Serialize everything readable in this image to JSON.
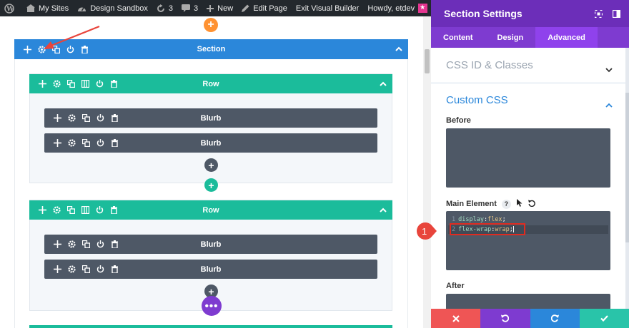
{
  "adminbar": {
    "my_sites": "My Sites",
    "site_name": "Design Sandbox",
    "updates": "3",
    "comments": "3",
    "new_label": "New",
    "edit_page": "Edit Page",
    "exit_builder": "Exit Visual Builder",
    "howdy": "Howdy, etdev"
  },
  "builder": {
    "section_label": "Section",
    "rows": [
      {
        "label": "Row",
        "modules": [
          "Blurb",
          "Blurb"
        ]
      },
      {
        "label": "Row",
        "modules": [
          "Blurb",
          "Blurb"
        ]
      }
    ],
    "colors": {
      "section": "#2b87da",
      "row": "#1bbc9b",
      "module": "#4e5866",
      "add_section": "#ff9232",
      "more": "#7e3bd0"
    }
  },
  "panel": {
    "title": "Section Settings",
    "tabs": [
      "Content",
      "Design",
      "Advanced"
    ],
    "active_tab": "Advanced",
    "groups": {
      "css_id": "CSS ID & Classes",
      "custom_css": "Custom CSS"
    },
    "fields": {
      "before": "Before",
      "main_element": "Main Element",
      "after": "After"
    },
    "code": [
      {
        "n": "1",
        "prop": "display",
        "value": "flex"
      },
      {
        "n": "2",
        "prop": "flex-wrap",
        "value": "wrap"
      }
    ],
    "callout_number": "1",
    "footer_colors": {
      "discard": "#ef5555",
      "undo": "#7e3bd0",
      "redo": "#2b87da",
      "save": "#29c4a9"
    }
  }
}
